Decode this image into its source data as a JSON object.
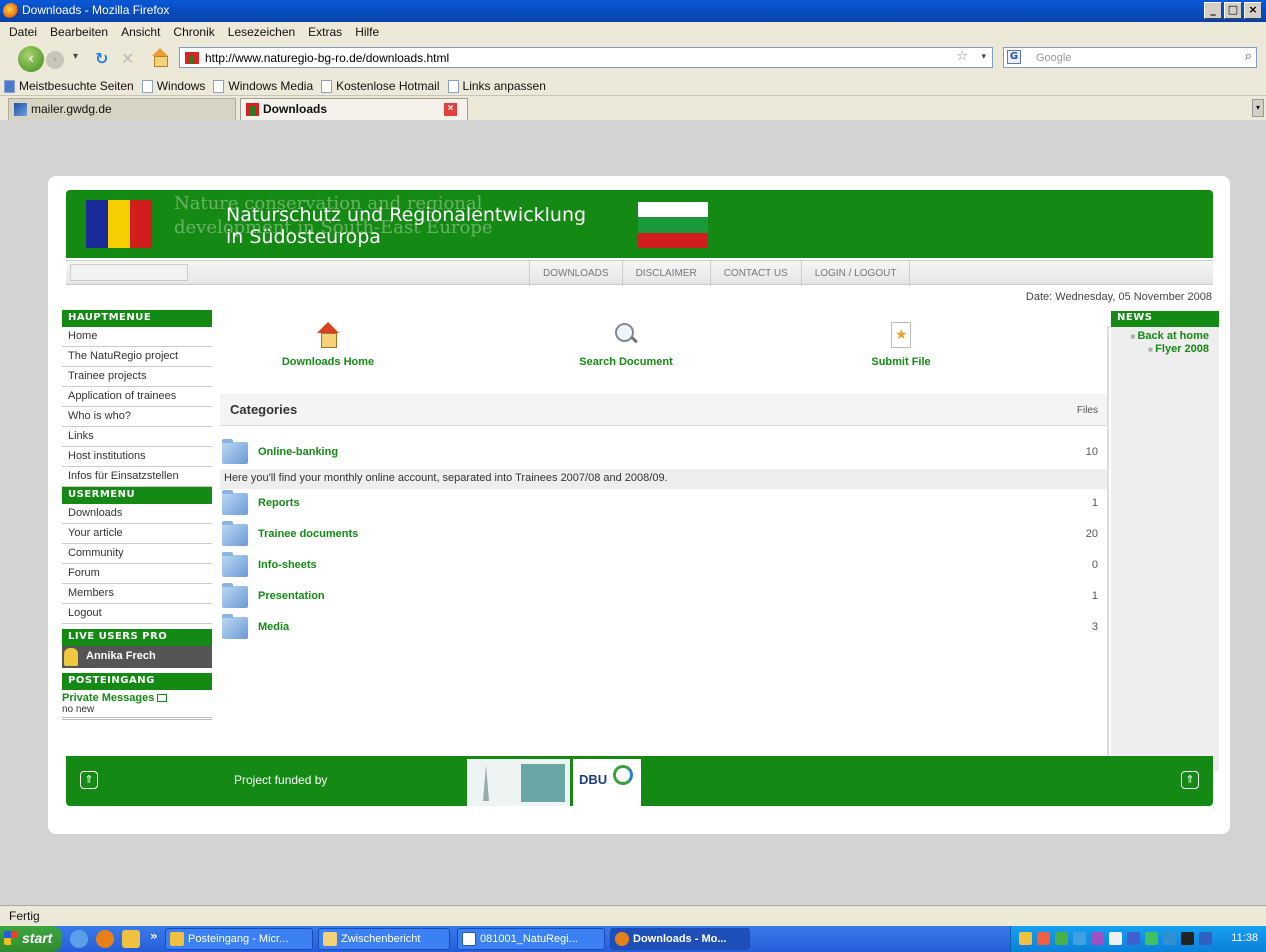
{
  "window": {
    "title": "Downloads - Mozilla Firefox",
    "buttons": [
      "_",
      "□",
      "×"
    ]
  },
  "menubar": [
    "Datei",
    "Bearbeiten",
    "Ansicht",
    "Chronik",
    "Lesezeichen",
    "Extras",
    "Hilfe"
  ],
  "navbar": {
    "url": "http://www.naturegio-bg-ro.de/downloads.html",
    "search_placeholder": "Google",
    "search_engine_badge": "G"
  },
  "bookmarks": [
    "Meistbesuchte Seiten",
    "Windows",
    "Windows Media",
    "Kostenlose Hotmail",
    "Links anpassen"
  ],
  "tabs": [
    {
      "label": "mailer.gwdg.de",
      "active": false
    },
    {
      "label": "Downloads",
      "active": true
    }
  ],
  "site": {
    "banner": {
      "ghost_text": "Nature conservation and regional\ndevelopment in South-East Europe",
      "title_line1": "Naturschutz und Regionalentwicklung",
      "title_line2": "in Südosteuropa",
      "flag_ro_colors": [
        "#1a2a9a",
        "#f6d000",
        "#d21d1d"
      ],
      "flag_bg_colors": [
        "#ffffff",
        "#1a9a3a",
        "#d21d1d"
      ]
    },
    "topnav": [
      "DOWNLOADS",
      "DISCLAIMER",
      "CONTACT US",
      "LOGIN / LOGOUT"
    ],
    "date": "Date: Wednesday, 05 November 2008",
    "hauptmenue": {
      "title": "HAUPTMENUE",
      "items": [
        "Home",
        "The NatuRegio project",
        "Trainee projects",
        "Application of trainees",
        "Who is who?",
        "Links",
        "Host institutions",
        "Infos für Einsatzstellen"
      ]
    },
    "usermenu": {
      "title": "USERMENU",
      "items": [
        "Downloads",
        "Your article",
        "Community",
        "Forum",
        "Members",
        "Logout"
      ]
    },
    "live_users": {
      "title": "LIVE USERS PRO",
      "user": "Annika Frech"
    },
    "posteingang": {
      "title": "POSTEINGANG",
      "private_messages": "Private Messages",
      "status": "no new"
    },
    "download_actions": [
      "Downloads Home",
      "Search Document",
      "Submit File"
    ],
    "categories": {
      "title": "Categories",
      "files_label": "Files",
      "items": [
        {
          "name": "Online-banking",
          "count": "10",
          "description": "Here you'll find your monthly online account, separated into Trainees 2007/08 and 2008/09."
        },
        {
          "name": "Reports",
          "count": "1"
        },
        {
          "name": "Trainee documents",
          "count": "20"
        },
        {
          "name": "Info-sheets",
          "count": "0"
        },
        {
          "name": "Presentation",
          "count": "1"
        },
        {
          "name": "Media",
          "count": "3"
        }
      ]
    },
    "news": {
      "title": "NEWS",
      "items": [
        "Back at home",
        "Flyer 2008"
      ]
    },
    "footer": {
      "funded_text": "Project funded by",
      "logo_dbu_text": "DBU",
      "up_arrow": "⇑"
    },
    "accent_color": "#148a14"
  },
  "statusbar": "Fertig",
  "taskbar": {
    "start": "start",
    "more": "»",
    "tasks": [
      {
        "label": "Posteingang - Micr...",
        "active": false
      },
      {
        "label": "Zwischenbericht",
        "active": false
      },
      {
        "label": "081001_NatuRegi...",
        "active": false
      },
      {
        "label": "Downloads - Mo...",
        "active": true
      }
    ],
    "clock": "11:38"
  }
}
